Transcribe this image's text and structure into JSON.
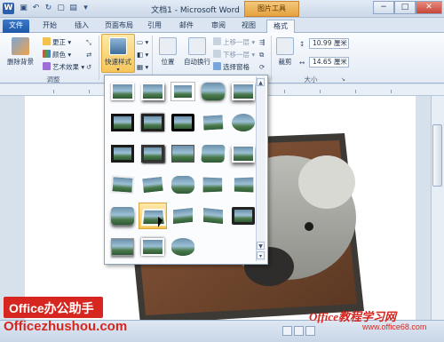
{
  "window": {
    "title": "文档1 - Microsoft Word",
    "context_tool": "图片工具",
    "controls": [
      "−",
      "□",
      "✕"
    ]
  },
  "tabs": [
    "文件",
    "开始",
    "插入",
    "页面布局",
    "引用",
    "邮件",
    "审阅",
    "视图",
    "格式"
  ],
  "ribbon": {
    "remove_background": "删除背景",
    "corrections": "更正",
    "color": "颜色",
    "artistic_effects": "艺术效果",
    "quick_styles": "快速样式",
    "adjust_group": "调整",
    "position": "位置",
    "wrap_text": "自动换行",
    "bring_forward": "上移一层",
    "send_backward": "下移一层",
    "selection_pane": "选择窗格",
    "crop": "裁剪",
    "height": "10.99 厘米",
    "width": "14.65 厘米",
    "size_group": "大小"
  },
  "gallery": {
    "rows": 6,
    "cols": 5,
    "count": 28,
    "hover_index": 21
  },
  "branding": {
    "left_badge": "Office办公助手",
    "left_url": "Officezhushou.com",
    "right_title": "Office教程学习网",
    "right_url": "www.office68.com"
  },
  "colors": {
    "accent": "#2b5fad",
    "context_tab": "#e6a13f",
    "brand_red": "#d7261f"
  }
}
